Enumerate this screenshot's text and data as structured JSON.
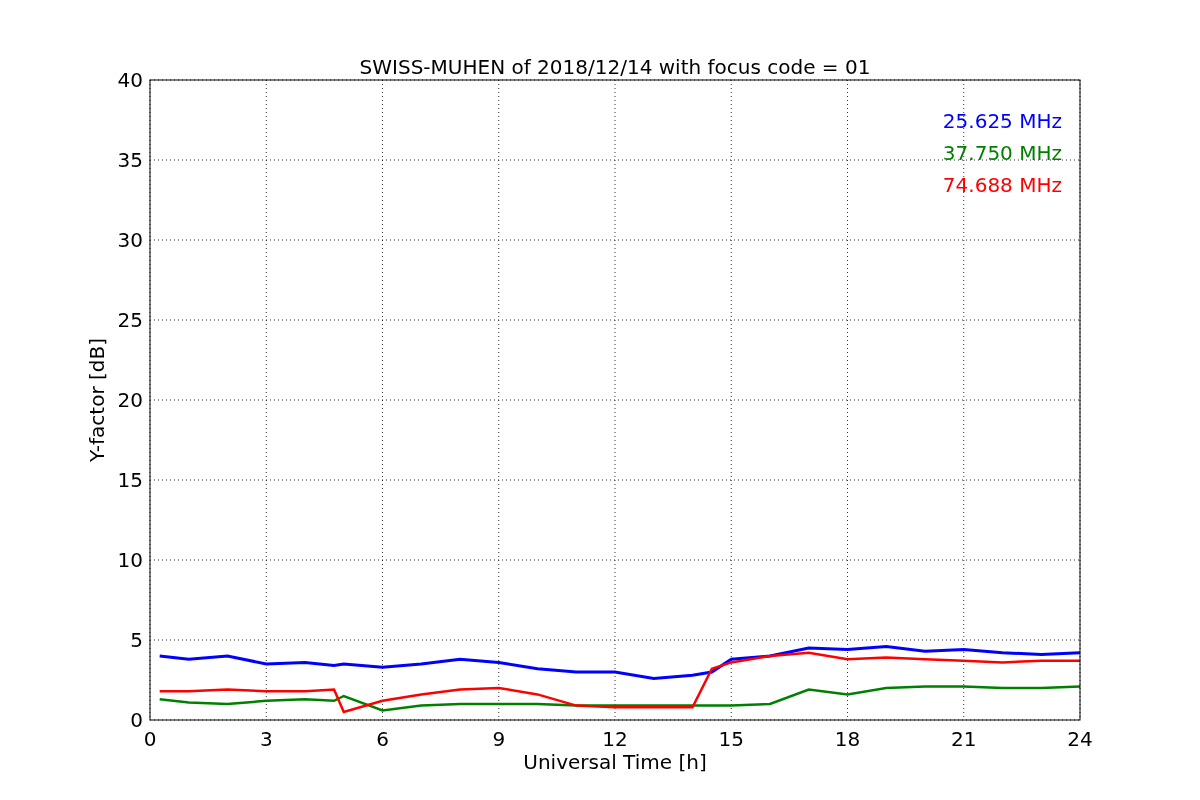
{
  "chart_data": {
    "type": "line",
    "title": "SWISS-MUHEN of 2018/12/14 with focus code = 01",
    "xlabel": "Universal Time [h]",
    "ylabel": "Y-factor [dB]",
    "x": [
      0.25,
      1,
      2,
      3,
      4,
      4.75,
      5,
      6,
      7,
      8,
      9,
      10,
      11,
      12,
      13,
      14,
      14.5,
      15,
      16,
      17,
      18,
      19,
      20,
      21,
      22,
      23,
      24
    ],
    "series": [
      {
        "name": "25.625 MHz",
        "color": "#0000ff",
        "values": [
          4,
          3.8,
          4,
          3.5,
          3.6,
          3.4,
          3.5,
          3.3,
          3.5,
          3.8,
          3.6,
          3.2,
          3,
          3,
          2.6,
          2.8,
          3,
          3.8,
          4,
          4.5,
          4.4,
          4.6,
          4.3,
          4.4,
          4.2,
          4.1,
          4.2
        ]
      },
      {
        "name": "37.750 MHz",
        "color": "#008000",
        "values": [
          1.3,
          1.1,
          1.0,
          1.2,
          1.3,
          1.2,
          1.5,
          0.6,
          0.9,
          1.0,
          1.0,
          1.0,
          0.9,
          0.9,
          0.9,
          0.9,
          0.9,
          0.9,
          1.0,
          1.9,
          1.6,
          2.0,
          2.1,
          2.1,
          2.0,
          2.0,
          2.1
        ]
      },
      {
        "name": "74.688 MHz",
        "color": "#ff0000",
        "values": [
          1.8,
          1.8,
          1.9,
          1.8,
          1.8,
          1.9,
          0.5,
          1.2,
          1.6,
          1.9,
          2.0,
          1.6,
          0.9,
          0.8,
          0.8,
          0.8,
          3.2,
          3.6,
          4.0,
          4.2,
          3.8,
          3.9,
          3.8,
          3.7,
          3.6,
          3.7,
          3.7
        ]
      }
    ],
    "grid": true,
    "xlim": [
      0,
      24
    ],
    "ylim": [
      0,
      40
    ],
    "xticks": [
      0,
      3,
      6,
      9,
      12,
      15,
      18,
      21,
      24
    ],
    "yticks": [
      0,
      5,
      10,
      15,
      20,
      25,
      30,
      35,
      40
    ]
  }
}
